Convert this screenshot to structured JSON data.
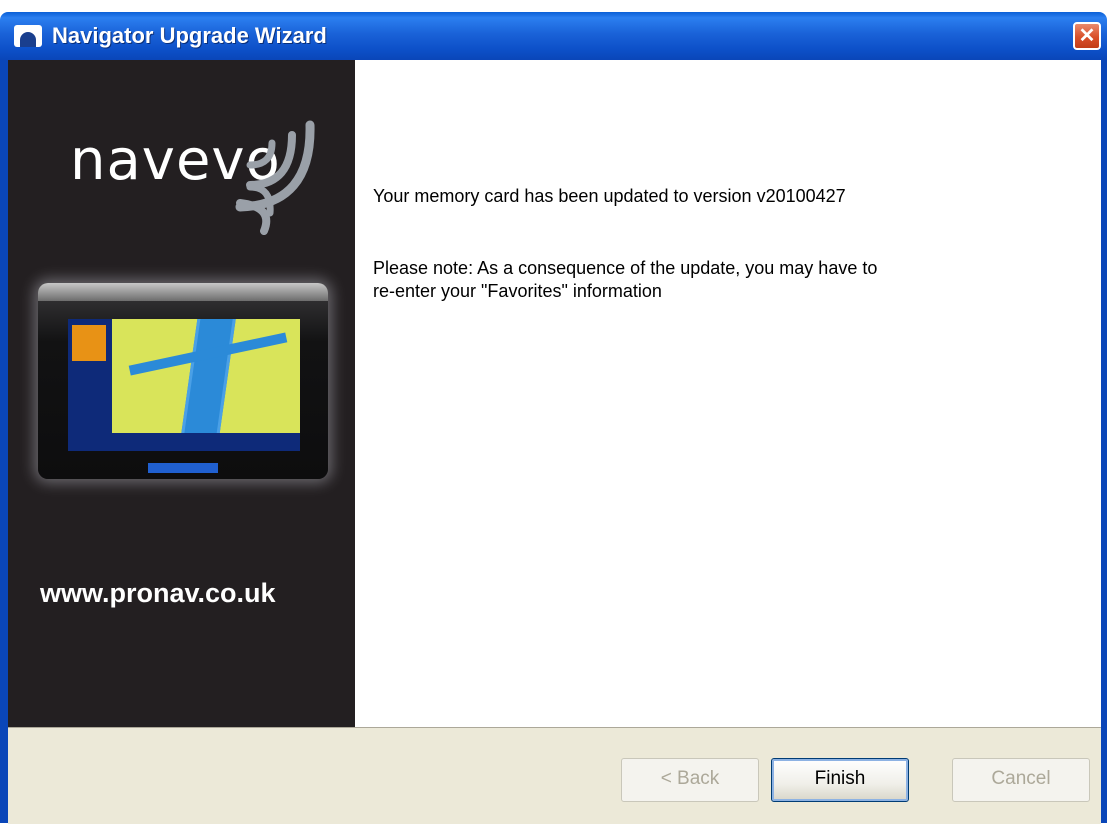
{
  "window": {
    "title": "Navigator Upgrade Wizard",
    "close_glyph": "✕"
  },
  "sidebar": {
    "logo_text": "navevo",
    "url_text": "www.pronav.co.uk"
  },
  "content": {
    "message_primary": "Your memory card has been updated to version v20100427",
    "message_note": "Please note: As a consequence of the update, you may have to\nre-enter your \"Favorites\" information"
  },
  "buttons": {
    "back_label": "< Back",
    "finish_label": "Finish",
    "cancel_label": "Cancel"
  },
  "colors": {
    "titlebar": "#0a46b8",
    "sidebar_bg": "#231f21",
    "button_bar": "#ece9d8",
    "close_button": "#d9502a"
  }
}
